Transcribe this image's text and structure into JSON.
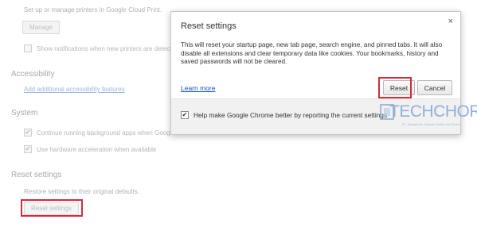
{
  "settings": {
    "cloud_print_text": "Set up or manage printers in Google Cloud Print.",
    "manage_label": "Manage",
    "notifications_label": "Show notifications when new printers are detected on the network",
    "accessibility": {
      "title": "Accessibility",
      "link": "Add additional accessibility features"
    },
    "system": {
      "title": "System",
      "background_apps_label": "Continue running background apps when Google Chrome is closed",
      "hw_accel_label": "Use hardware acceleration when available"
    },
    "reset": {
      "title": "Reset settings",
      "description": "Restore settings to their original defaults.",
      "button_label": "Reset settings"
    }
  },
  "dialog": {
    "title": "Reset settings",
    "close_glyph": "×",
    "body": "This will reset your startup page, new tab page, search engine, and pinned tabs. It will also disable all extensions and clear temporary data like cookies. Your bookmarks, history and saved passwords will not be cleared.",
    "learn_more": "Learn more",
    "reset_label": "Reset",
    "cancel_label": "Cancel",
    "footer_checkbox_label": "Help make Google Chrome better by reporting the current settings",
    "footer_checked": true
  },
  "watermark": {
    "text": "TECHCHORE",
    "tagline": "PC, Smartphone, Software Guides and Reviews"
  },
  "colors": {
    "highlight": "#d9283a",
    "link": "#1155cc"
  }
}
